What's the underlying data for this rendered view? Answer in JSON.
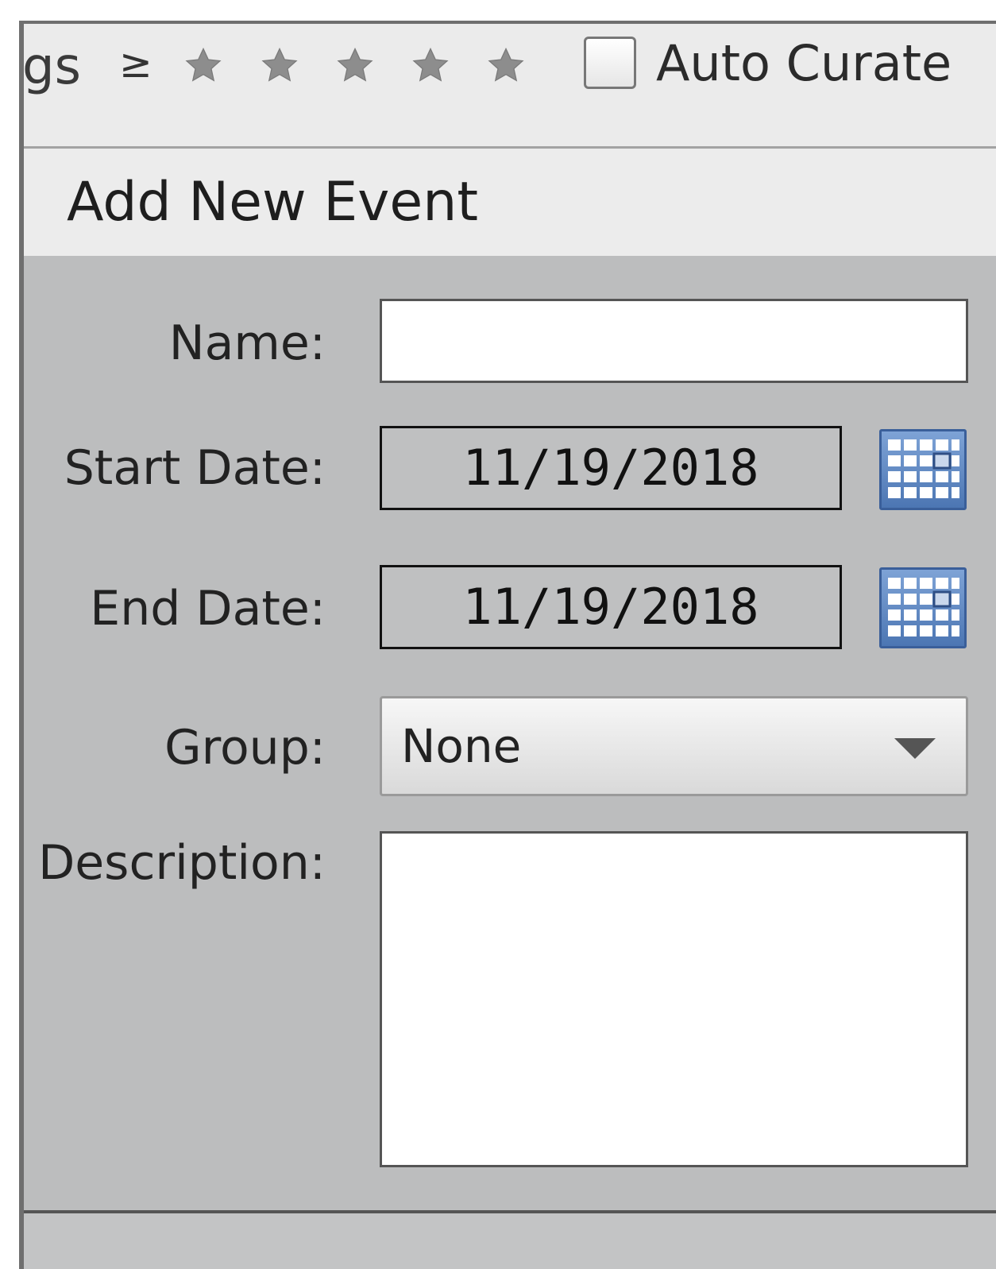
{
  "toolbar": {
    "filter_label": "gs",
    "rating_operator": "≥",
    "stars": [
      "star",
      "star",
      "star",
      "star",
      "star"
    ],
    "auto_curate_label": "Auto Curate",
    "auto_curate_checked": false
  },
  "panel": {
    "title": "Add New Event",
    "fields": {
      "name_label": "Name:",
      "name_value": "",
      "start_date_label": "Start Date:",
      "start_date_value": "11/19/2018",
      "end_date_label": "End Date:",
      "end_date_value": "11/19/2018",
      "group_label": "Group:",
      "group_value": "None",
      "description_label": "Description:",
      "description_value": ""
    }
  },
  "icons": {
    "star": "star-icon",
    "calendar": "calendar-icon",
    "dropdown": "chevron-down-icon"
  },
  "colors": {
    "panel_background": "#bcbdbe",
    "calendar_button": "#4c76b3"
  }
}
